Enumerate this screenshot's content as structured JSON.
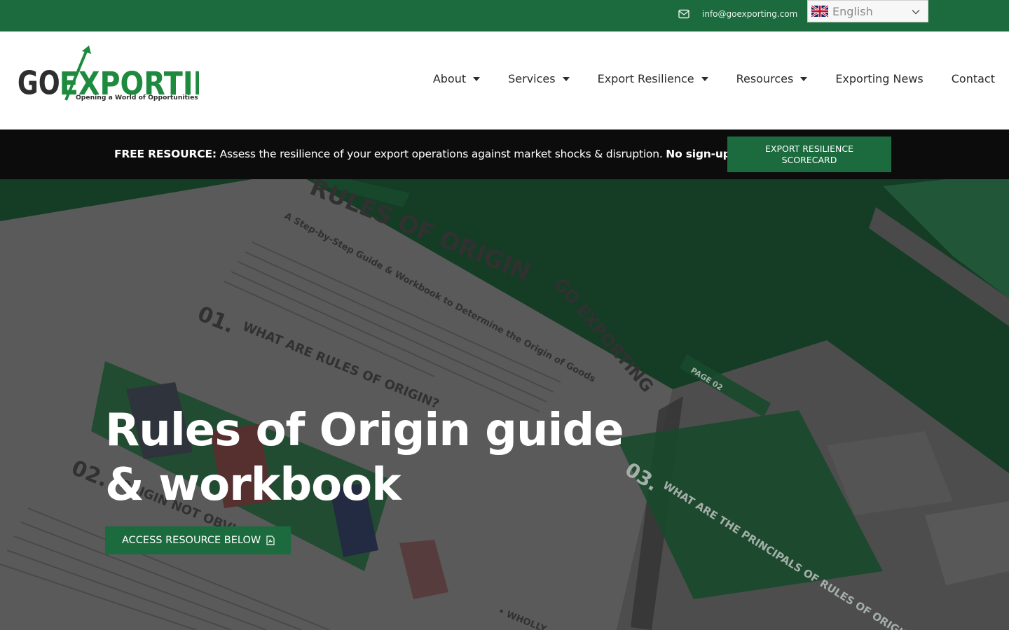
{
  "topbar": {
    "email": "info@goexporting.com",
    "language": "English"
  },
  "logo": {
    "word1": "GO",
    "word2": "EXPORTING",
    "tagline": "Opening a World of Opportunities"
  },
  "nav": {
    "items": [
      {
        "label": "About",
        "has_dropdown": true
      },
      {
        "label": "Services",
        "has_dropdown": true
      },
      {
        "label": "Export Resilience",
        "has_dropdown": true
      },
      {
        "label": "Resources",
        "has_dropdown": true
      },
      {
        "label": "Exporting News",
        "has_dropdown": false
      },
      {
        "label": "Contact",
        "has_dropdown": false
      }
    ]
  },
  "promo": {
    "lead": "FREE RESOURCE:",
    "body": " Assess the resilience of your export operations against market shocks & disruption. ",
    "tail": "No sign-up required.",
    "button": "EXPORT RESILIENCE SCORECARD"
  },
  "hero": {
    "title": "Rules of Origin guide & workbook",
    "cta": "ACCESS RESOURCE BELOW",
    "book": {
      "heading": "RULES OF ORIGIN",
      "subheading": "A Step-by-Step Guide & Workbook to Determine the Origin of Goods",
      "section1_num": "01.",
      "section1": "WHAT ARE RULES OF ORIGIN?",
      "section2_num": "02.",
      "section2": "ORIGIN NOT OBVIOUS",
      "section3_num": "03.",
      "section3": "WHAT ARE THE PRINCIPALS OF RULES OF ORIGIN?",
      "page_tag": "PAGE 02",
      "page_logo": "GO EXPORTING",
      "footer": "• WHOLLY"
    }
  },
  "colors": {
    "brand_green": "#1b6b3e",
    "promo_bg": "#0c0c0c",
    "hero_bg": "#143f26"
  }
}
